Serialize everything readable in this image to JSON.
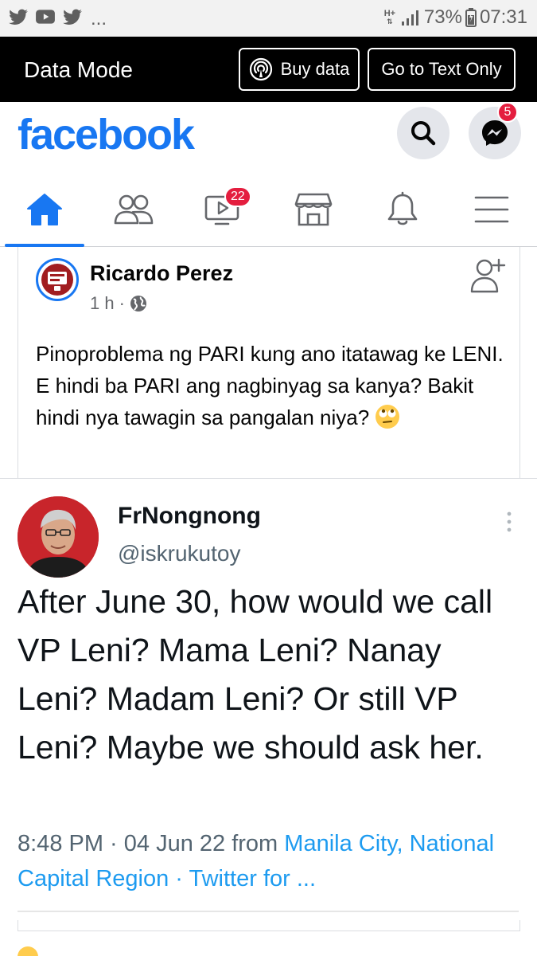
{
  "status_bar": {
    "left_icons": [
      "twitter-icon",
      "youtube-icon",
      "twitter-icon"
    ],
    "more": "...",
    "network": "H+",
    "battery": "73%",
    "time": "07:31"
  },
  "data_mode": {
    "title": "Data Mode",
    "buy_label": "Buy data",
    "text_only_label": "Go to Text Only"
  },
  "header": {
    "logo": "facebook",
    "messenger_badge": "5",
    "brand_color": "#1877f2"
  },
  "nav": {
    "video_badge": "22",
    "tabs": [
      "home-icon",
      "friends-icon",
      "watch-icon",
      "marketplace-icon",
      "notifications-icon",
      "menu-icon"
    ]
  },
  "post": {
    "author": "Ricardo Perez",
    "time": "1 h",
    "separator": "·",
    "text": "Pinoproblema ng PARI kung ano itatawag ke LENI. E hindi ba PARI ang nagbinyag sa kanya? Bakit hindi nya tawagin sa pangalan niya?",
    "emoji": "face-with-rolling-eyes-icon"
  },
  "tweet": {
    "name": "FrNongnong",
    "handle": "@iskrukutoy",
    "text": "After June 30, how would we call VP Leni? Mama Leni? Nanay Leni? Madam Leni? Or still VP Leni? Maybe we should ask her.",
    "time_date": "8:48 PM · 04 Jun 22 from ",
    "location": "Manila City, National Capital Region",
    "meta_sep": " · ",
    "client": "Twitter for ..."
  }
}
